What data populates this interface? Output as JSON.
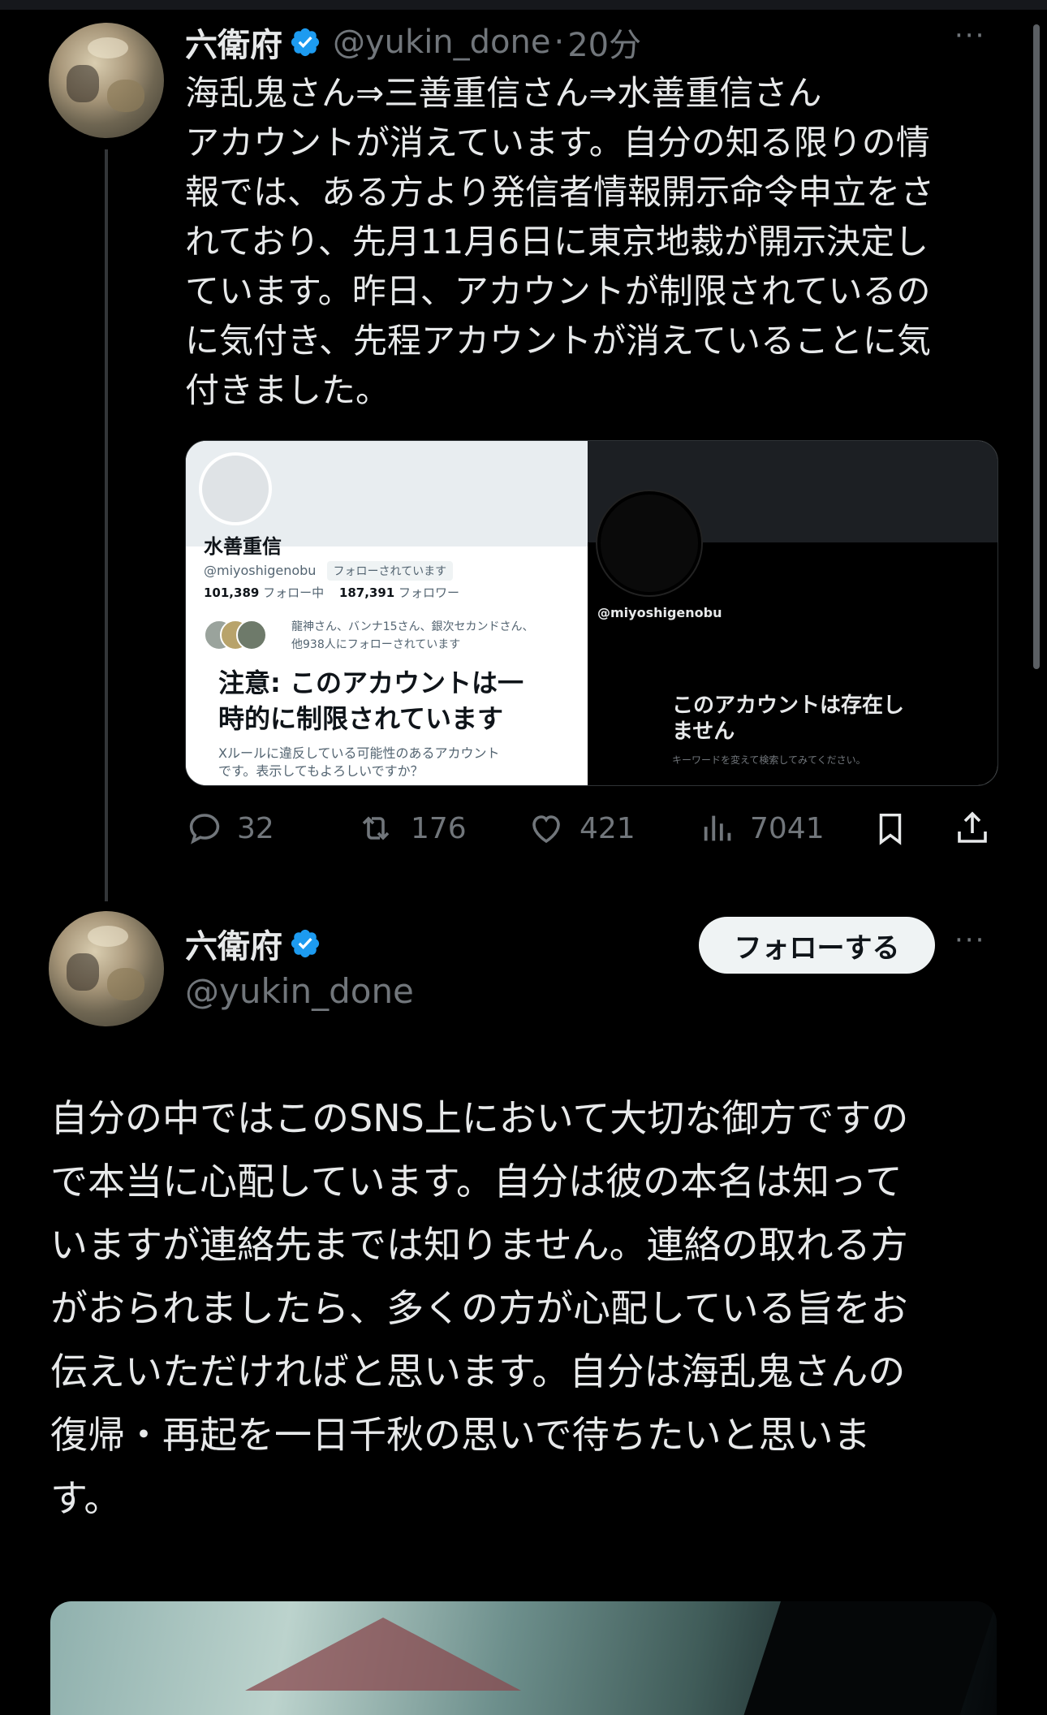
{
  "tweet1": {
    "display_name": "六衛府",
    "handle": "@yukin_done",
    "separator": "·",
    "time": "20分",
    "more": "···",
    "text_lines": [
      "海乱鬼さん⇒三善重信さん⇒水善重信さん",
      "アカウントが消えています。自分の知る限りの情",
      "報では、ある方より発信者情報開示命令申立をさ",
      "れており、先月11月6日に東京地裁が開示決定し",
      "ています。昨日、アカウントが制限されているの",
      "に気付き、先程アカウントが消えていることに気",
      "付きました。"
    ],
    "card_left": {
      "name": "水善重信",
      "handle": "@miyoshigenobu",
      "follows_you": "フォローされています",
      "following_count": "101,389",
      "following_label": "フォロー中",
      "followers_count": "187,391",
      "followers_label": "フォロワー",
      "mutuals_line1": "龍神さん、バンナ15さん、銀次セカンドさん、",
      "mutuals_line2": "他938人にフォローされています",
      "warning_line1": "注意: このアカウントは一",
      "warning_line2": "時的に制限されています",
      "sub_line1": "Xルールに違反している可能性のあるアカウント",
      "sub_line2": "です。表示してもよろしいですか？"
    },
    "card_right": {
      "handle": "@miyoshigenobu",
      "title_line1": "このアカウントは存在し",
      "title_line2": "ません",
      "sub": "キーワードを変えて検索してみてください。"
    },
    "actions": {
      "replies": "32",
      "reposts": "176",
      "likes": "421",
      "views": "7041"
    }
  },
  "tweet2": {
    "display_name": "六衛府",
    "handle": "@yukin_done",
    "follow_button": "フォローする",
    "more": "···",
    "text_lines": [
      "自分の中ではこのSNS上において大切な御方ですの",
      "で本当に心配しています。自分は彼の本名は知って",
      "いますが連絡先までは知りません。連絡の取れる方",
      "がおられましたら、多くの方が心配している旨をお",
      "伝えいただければと思います。自分は海乱鬼さんの",
      "復帰・再起を一日千秋の思いで待ちたいと思いま",
      "す。"
    ]
  },
  "colors": {
    "background": "#000000",
    "text": "#e7e9ea",
    "muted": "#71767b",
    "verified": "#1d9bf0"
  }
}
